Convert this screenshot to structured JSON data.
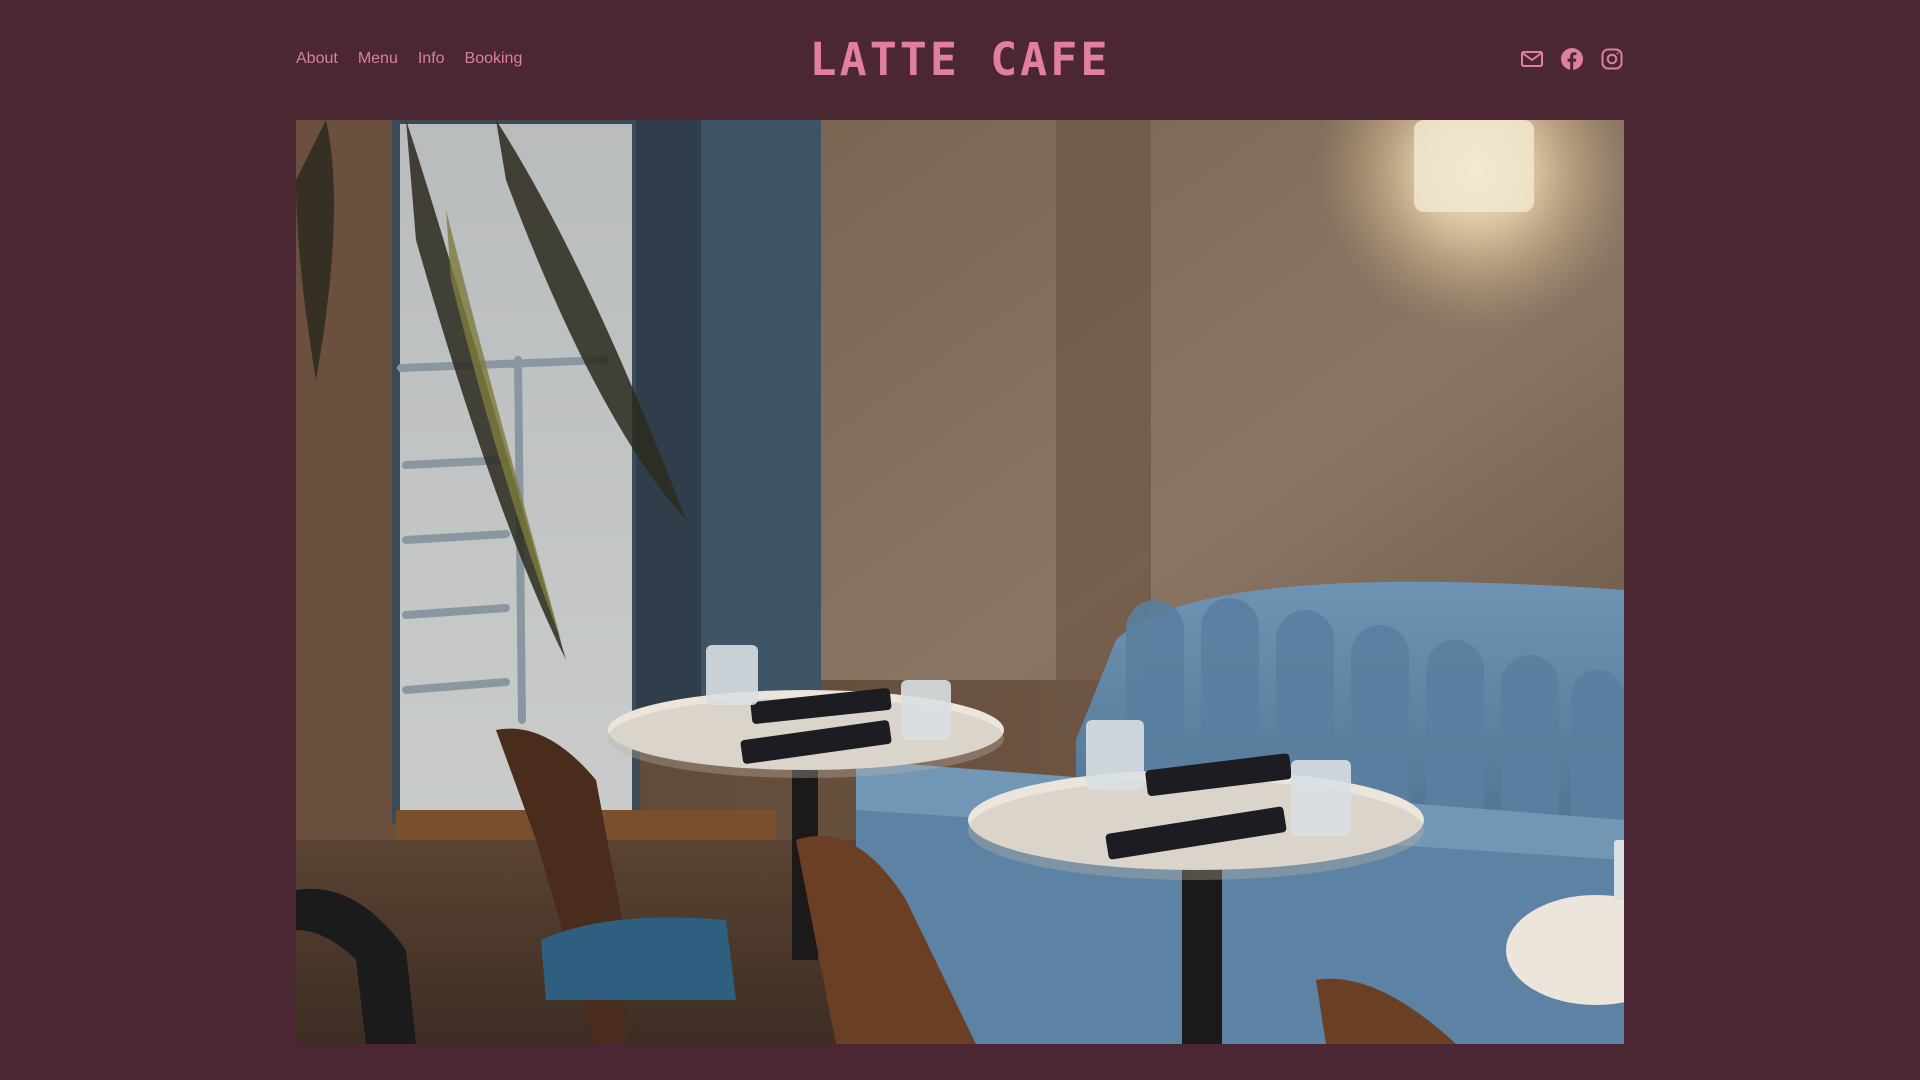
{
  "brand": {
    "name": "LATTE CAFE"
  },
  "nav": {
    "items": [
      "About",
      "Menu",
      "Info",
      "Booking"
    ]
  },
  "social": {
    "icons": [
      "mail-icon",
      "facebook-icon",
      "instagram-icon"
    ]
  },
  "colors": {
    "background": "#4a2733",
    "accent": "#e07f9e",
    "nav_text": "#d9809a"
  },
  "hero": {
    "subject": "cafe interior photo"
  }
}
